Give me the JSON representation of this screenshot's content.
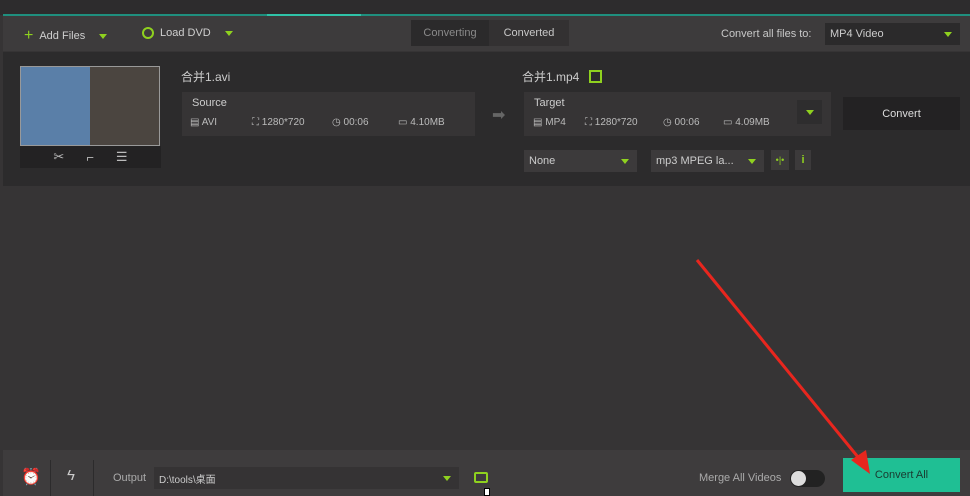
{
  "toolbar": {
    "add_files": "Add Files",
    "load_dvd": "Load DVD",
    "tab_converting": "Converting",
    "tab_converted": "Converted",
    "convert_all_label": "Convert all files to:",
    "format_value": "MP4 Video"
  },
  "item": {
    "source_name": "合并1.avi",
    "source_label": "Source",
    "source": {
      "format": "AVI",
      "resolution": "1280*720",
      "duration": "00:06",
      "size": "4.10MB"
    },
    "target_name": "合并1.mp4",
    "target_label": "Target",
    "target": {
      "format": "MP4",
      "resolution": "1280*720",
      "duration": "00:06",
      "size": "4.09MB"
    },
    "subtitle": "None",
    "audio": "mp3 MPEG la...",
    "convert_button": "Convert",
    "info_glyph": "i"
  },
  "bottom": {
    "output_label": "Output",
    "output_path": "D:\\tools\\桌面",
    "merge_label": "Merge All Videos",
    "convert_all_button": "Convert All"
  }
}
